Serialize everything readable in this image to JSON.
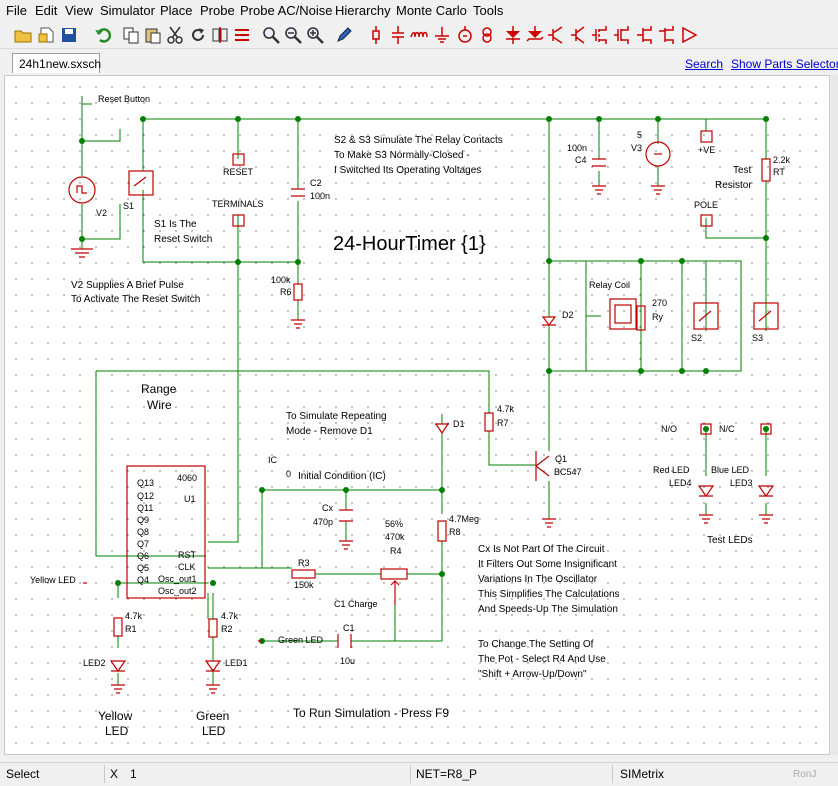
{
  "menu": [
    "File",
    "Edit",
    "View",
    "Simulator",
    "Place",
    "Probe",
    "Probe AC/Noise",
    "Hierarchy",
    "Monte Carlo",
    "Tools"
  ],
  "tab": {
    "label": "24h1new.sxsch"
  },
  "links": {
    "search": "Search",
    "parts_selector": "Show Parts Selector"
  },
  "toolbar_icons": [
    "open-folder-icon",
    "open-file-icon",
    "save-icon",
    "undo-icon",
    "copy-icon",
    "paste-icon",
    "cut-icon",
    "rotate-icon",
    "mirror-icon",
    "delete-icon",
    "zoom-full-icon",
    "zoom-out-icon",
    "zoom-in-icon",
    "pencil-icon",
    "resistor-icon",
    "capacitor-icon",
    "inductor-icon",
    "ground-icon",
    "voltage-source-icon",
    "current-source-icon",
    "diode-icon",
    "zener-icon",
    "npn-icon",
    "pnp-icon",
    "nmos-icon",
    "pmos-icon",
    "opamp-icon"
  ],
  "schematic": {
    "title": "24-HourTimer {1}",
    "notes": {
      "s2_s3_1": "S2 & S3 Simulate The Relay Contacts",
      "s2_s3_2": "To Make S3 Normally-Closed -",
      "s2_s3_3": "I Switched Its Operating Voltages",
      "s1_1": "S1 Is The",
      "s1_2": "Reset Switch",
      "v2_1": "V2 Supplies A Brief Pulse",
      "v2_2": "To Activate The Reset Switch",
      "range_1": "Range",
      "range_2": "Wire",
      "repeat_1": "To Simulate Repeating",
      "repeat_2": "Mode - Remove D1",
      "ic_cond": "Initial Condition (IC)",
      "cx_1": "Cx Is Not Part Of The Circuit",
      "cx_2": "It Filters Out Some Insignificant",
      "cx_3": "Variations In The Oscillator",
      "cx_4": "This Simplifies The Calculations",
      "cx_5": "And Speeds-Up The Simulation",
      "pot_1": "To Change The Setting Of",
      "pot_2": "The Pot - Select R4 And Use",
      "pot_3": "\"Shift + Arrow-Up/Down\"",
      "run": "To Run Simulation - Press F9",
      "test_leds": "Test LEDs",
      "yellow_1": "Yellow",
      "yellow_2": "LED",
      "green_1": "Green",
      "green_2": "LED",
      "test_res_1": "Test",
      "test_res_2": "Resistor"
    },
    "labels": {
      "reset_button": "Reset Button",
      "v2": "V2",
      "s1": "S1",
      "reset": "RESET",
      "terminals": "TERMINALS",
      "c2": "C2",
      "c2_val": "100n",
      "r6_val": "100k",
      "r6": "R6",
      "c4_val": "100n",
      "c4": "C4",
      "v3_val": "5",
      "v3": "V3",
      "ve": "+VE",
      "rt_val": "2.2k",
      "rt": "RT",
      "pole": "POLE",
      "relay_coil": "Relay Coil",
      "ry_val": "270",
      "ry": "Ry",
      "d2": "D2",
      "s2": "S2",
      "s3": "S3",
      "r7_val": "4.7k",
      "r7": "R7",
      "d1": "D1",
      "q1": "Q1",
      "q1_type": "BC547",
      "no": "N/O",
      "nc": "N/C",
      "red_led": "Red LED",
      "blue_led": "Blue LED",
      "led4": "LED4",
      "led3": "LED3",
      "ic": "IC",
      "ic_val": "0",
      "cx": "Cx",
      "cx_val": "470p",
      "r8_val": "4.7Meg",
      "r8": "R8",
      "pot_pct": "56%",
      "pot_val": "470k",
      "r4": "R4",
      "r3": "R3",
      "r3_val": "150k",
      "c1_charge": "C1 Charge",
      "c1": "C1",
      "c1_val": "10u",
      "green_led_probe": "Green LED",
      "yellow_led_probe": "Yellow LED",
      "r1_val": "4.7k",
      "r1": "R1",
      "r2_val": "4.7k",
      "r2": "R2",
      "led2": "LED2",
      "led1": "LED1",
      "u1_type": "4060",
      "u1": "U1",
      "u1_pins_left": [
        "Q13",
        "Q12",
        "Q11",
        "Q9",
        "Q8",
        "Q7",
        "Q6",
        "Q5",
        "Q4"
      ],
      "u1_pins_right": [
        "RST",
        "CLK",
        "Osc_out1",
        "Osc_out2"
      ]
    }
  },
  "status": {
    "mode": "Select",
    "x_label": "X",
    "x_value": "1",
    "net": "NET=R8_P",
    "app": "SIMetrix",
    "user": "RonJ"
  }
}
